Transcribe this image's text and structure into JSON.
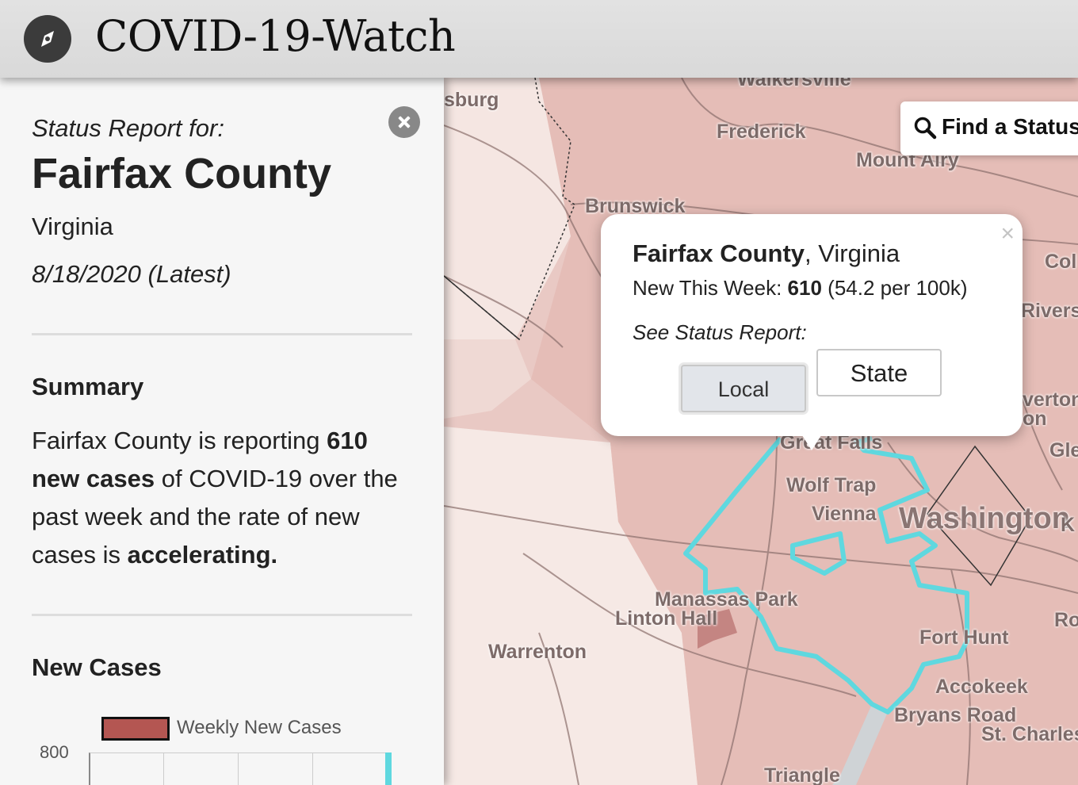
{
  "app": {
    "title": "COVID-19-Watch",
    "logo_icon": "compass-icon"
  },
  "find": {
    "label": "Find a Status",
    "icon": "search-icon"
  },
  "sidebar": {
    "status_for": "Status Report for:",
    "county": "Fairfax County",
    "state": "Virginia",
    "date": "8/18/2020 (Latest)",
    "summary_heading": "Summary",
    "summary": {
      "pre": "Fairfax County is reporting ",
      "count": "610",
      "count_label": " new cases",
      "mid": " of COVID-19 over the past week and the rate of new cases is ",
      "trend": "accelerating."
    },
    "new_cases_heading": "New Cases",
    "legend_label": "Weekly New Cases",
    "y_tick": "800",
    "close_icon": "close-circle-icon"
  },
  "popup": {
    "county": "Fairfax County",
    "state_suffix": ", Virginia",
    "week_label": "New This Week: ",
    "week_value": "610",
    "week_rate": " (54.2 per 100k)",
    "see_label": "See Status Report:",
    "local_label": "Local",
    "state_label": "State",
    "close": "×"
  },
  "map": {
    "labels": [
      "sburg",
      "Frederick",
      "Mount Airy",
      "Brunswick",
      "Col",
      "Rivers",
      "verton",
      "on",
      "Gle",
      "Great Falls",
      "Wolf Trap",
      "Vienna",
      "Washington",
      "K",
      "Manassas Park",
      "Linton Hall",
      "Warrenton",
      "Fort Hunt",
      "Ro",
      "Accokeek",
      "Bryans Road",
      "St. Charles",
      "Triangle",
      "Walkersville"
    ],
    "highlight_color": "#5fd8df",
    "fill_color": "#e8c6c1"
  },
  "colors": {
    "accent": "#5fd8df",
    "bar": "#b45652",
    "header_bg": "#dcdcdc"
  }
}
